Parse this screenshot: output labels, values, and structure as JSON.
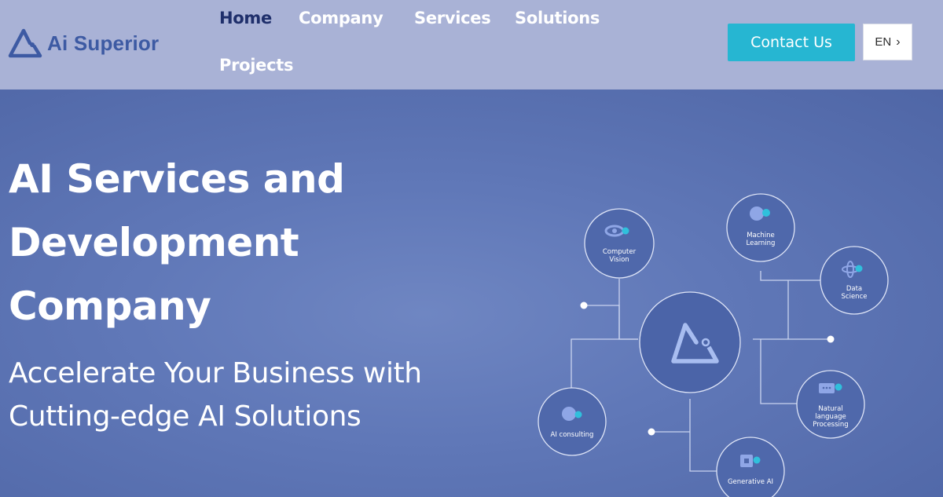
{
  "brand": {
    "name": "Ai Superior"
  },
  "nav": {
    "items": [
      {
        "label": "Home",
        "active": true
      },
      {
        "label": "Company",
        "active": false
      },
      {
        "label": "Services",
        "active": false
      },
      {
        "label": "Solutions",
        "active": false
      },
      {
        "label": "Projects",
        "active": false
      }
    ],
    "contact_label": "Contact Us",
    "language": "EN"
  },
  "hero": {
    "title": "AI Services and Development Company",
    "subtitle": "Accelerate Your Business with Cutting-edge AI Solutions"
  },
  "diagram": {
    "nodes": {
      "computer_vision": [
        "Computer",
        "Vision"
      ],
      "machine_learning": [
        "Machine",
        "Learning"
      ],
      "data_science": [
        "Data",
        "Science"
      ],
      "nlp": [
        "Natural",
        "language",
        "Processing"
      ],
      "generative_ai": [
        "Generative AI"
      ],
      "ai_consulting": [
        "AI consulting"
      ]
    }
  },
  "colors": {
    "header_bg": "#a9b2d6",
    "hero_bg": "#6078b8",
    "brand_blue": "#3d5aa3",
    "nav_active": "#1f2f6b",
    "accent_cyan": "#26b6d2"
  }
}
